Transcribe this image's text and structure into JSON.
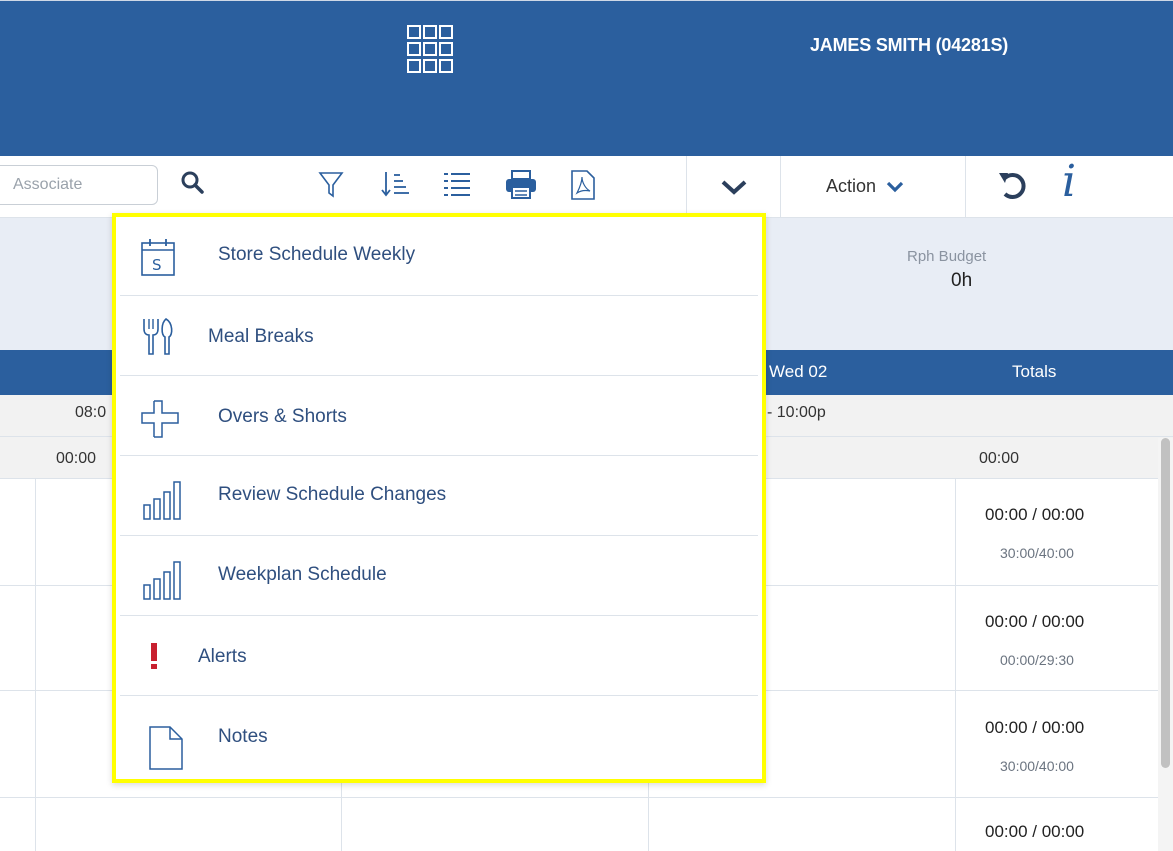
{
  "header": {
    "user_name": "JAMES SMITH (04281S)",
    "apps_icon": "grid-apps-icon"
  },
  "toolbar": {
    "search_placeholder": "Associate",
    "action_label": "Action"
  },
  "summary": {
    "rph_budget_label": "Rph Budget",
    "rph_budget_value": "0h"
  },
  "week": {
    "day_label": "Wed 02",
    "totals_label": "Totals",
    "hours_left": "08:0",
    "hours_mid": "- 10:00p",
    "totals_left": "00:00",
    "totals_right": "00:00"
  },
  "rows": [
    {
      "total": "00:00 / 00:00",
      "sub": "30:00/40:00"
    },
    {
      "total": "00:00 / 00:00",
      "sub": "00:00/29:30"
    },
    {
      "total": "00:00 / 00:00",
      "sub": "30:00/40:00"
    },
    {
      "total": "00:00 / 00:00",
      "sub": ""
    }
  ],
  "menu": {
    "items": [
      {
        "label": "Store Schedule Weekly",
        "icon": "calendar-icon"
      },
      {
        "label": "Meal Breaks",
        "icon": "utensils-icon"
      },
      {
        "label": "Overs & Shorts",
        "icon": "overs-shorts-icon"
      },
      {
        "label": "Review Schedule Changes",
        "icon": "bar-chart-icon"
      },
      {
        "label": "Weekplan Schedule",
        "icon": "bar-chart-icon"
      },
      {
        "label": "Alerts",
        "icon": "alert-icon"
      },
      {
        "label": "Notes",
        "icon": "document-icon"
      }
    ]
  },
  "colors": {
    "primary": "#2b5f9e",
    "highlight": "#ffff00",
    "alert": "#c8202f"
  }
}
